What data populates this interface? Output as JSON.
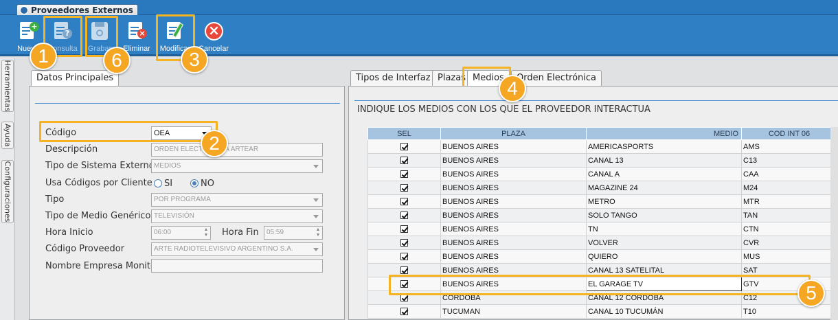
{
  "window_tab": "Proveedores Externos",
  "toolbar": {
    "buttons": [
      {
        "label": "Nuevo",
        "enabled": true
      },
      {
        "label": "Consulta",
        "enabled": false
      },
      {
        "label": "Grabar",
        "enabled": false
      },
      {
        "label": "Eliminar",
        "enabled": true
      },
      {
        "label": "Modificar",
        "enabled": true
      },
      {
        "label": "Cancelar",
        "enabled": true
      }
    ]
  },
  "side_tabs": [
    "Herramientas",
    "Ayuda",
    "Configuraciones"
  ],
  "left_tab": "Datos Principales",
  "form": {
    "codigo_label": "Código",
    "codigo_value": "OEA",
    "descripcion_label": "Descripción",
    "descripcion_value": "ORDEN ELECTRÓNICA ARTEAR",
    "tipo_sistema_label": "Tipo de Sistema Externo",
    "tipo_sistema_value": "MEDIOS",
    "usa_codigos_label": "Usa Códigos por Cliente",
    "radio_si": "SI",
    "radio_no": "NO",
    "radio_selected": "NO",
    "tipo_label": "Tipo",
    "tipo_value": "POR PROGRAMA",
    "tipo_medio_label": "Tipo de Medio Genérico",
    "tipo_medio_value": "TELEVISIÓN",
    "hora_inicio_label": "Hora Inicio",
    "hora_inicio_value": "06:00",
    "hora_fin_label": "Hora Fin",
    "hora_fin_value": "05:59",
    "codigo_proveedor_label": "Código Proveedor",
    "codigo_proveedor_value": "ARTE RADIOTELEVISIVO ARGENTINO S.A.",
    "nombre_empresa_label": "Nombre Empresa Monitor",
    "nombre_empresa_value": ""
  },
  "right_tabs": [
    "Tipos de Interfaz",
    "Plazas",
    "Medios",
    "Orden Electrónica"
  ],
  "right_active_tab": "Medios",
  "heading": "INDIQUE LOS MEDIOS CON LOS QUE EL PROVEEDOR INTERACTUA",
  "table": {
    "columns": [
      "SEL",
      "PLAZA",
      "MEDIO",
      "COD INT 06"
    ],
    "rows": [
      {
        "sel": true,
        "plaza": "BUENOS AIRES",
        "medio": "AMERICASPORTS",
        "cod": "AMS"
      },
      {
        "sel": true,
        "plaza": "BUENOS AIRES",
        "medio": "CANAL 13",
        "cod": "C13"
      },
      {
        "sel": true,
        "plaza": "BUENOS AIRES",
        "medio": "CANAL A",
        "cod": "CAA"
      },
      {
        "sel": true,
        "plaza": "BUENOS AIRES",
        "medio": "MAGAZINE 24",
        "cod": "M24"
      },
      {
        "sel": true,
        "plaza": "BUENOS AIRES",
        "medio": "METRO",
        "cod": "MTR"
      },
      {
        "sel": true,
        "plaza": "BUENOS AIRES",
        "medio": "SOLO TANGO",
        "cod": "TAN"
      },
      {
        "sel": true,
        "plaza": "BUENOS AIRES",
        "medio": "TN",
        "cod": "CTN"
      },
      {
        "sel": true,
        "plaza": "BUENOS AIRES",
        "medio": "VOLVER",
        "cod": "CVR"
      },
      {
        "sel": true,
        "plaza": "BUENOS AIRES",
        "medio": "QUIERO",
        "cod": "MUS"
      },
      {
        "sel": true,
        "plaza": "BUENOS AIRES",
        "medio": "CANAL 13 SATELITAL",
        "cod": "SAT"
      },
      {
        "sel": true,
        "plaza": "BUENOS AIRES",
        "medio": "EL GARAGE TV",
        "cod": "GTV"
      },
      {
        "sel": true,
        "plaza": "CORDOBA",
        "medio": "CANAL 12 CORDOBA",
        "cod": "C12"
      },
      {
        "sel": true,
        "plaza": "TUCUMAN",
        "medio": "CANAL 10 TUCUMÁN",
        "cod": "T10"
      }
    ]
  },
  "callouts": [
    "1",
    "2",
    "3",
    "4",
    "5",
    "6"
  ],
  "colors": {
    "toolbar": "#2f7fc4",
    "highlight": "#f5b323",
    "callout": "#f5a623",
    "table_header": "#a6c4df"
  }
}
